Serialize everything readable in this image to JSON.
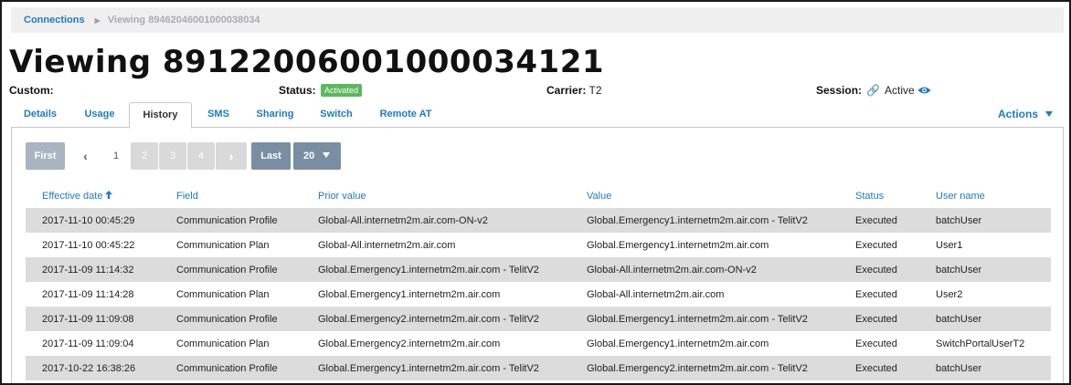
{
  "breadcrumb": {
    "root": "Connections",
    "current": "Viewing 89462046001000038034"
  },
  "page_title": "Viewing 89122006001000034121",
  "info": {
    "custom_label": "Custom:",
    "custom_value": "",
    "status_label": "Status:",
    "status_value": "Activated",
    "status_color": "#5cb85c",
    "carrier_label": "Carrier:",
    "carrier_value": "T2",
    "session_label": "Session:",
    "session_value": "Active",
    "session_icons": [
      "link-icon",
      "eye-icon"
    ]
  },
  "tabs": [
    {
      "label": "Details",
      "active": false
    },
    {
      "label": "Usage",
      "active": false
    },
    {
      "label": "History",
      "active": true
    },
    {
      "label": "SMS",
      "active": false
    },
    {
      "label": "Sharing",
      "active": false
    },
    {
      "label": "Switch",
      "active": false
    },
    {
      "label": "Remote AT",
      "active": false
    }
  ],
  "actions_label": "Actions",
  "pagination": {
    "first": "First",
    "pages": [
      "1",
      "2",
      "3",
      "4"
    ],
    "current_page": "1",
    "last": "Last",
    "page_size": "20"
  },
  "table": {
    "columns": [
      "Effective date",
      "Field",
      "Prior value",
      "Value",
      "Status",
      "User name"
    ],
    "sorted_column": "Effective date",
    "rows": [
      [
        "2017-11-10 00:45:29",
        "Communication Profile",
        "Global-All.internetm2m.air.com-ON-v2",
        "Global.Emergency1.internetm2m.air.com - TelitV2",
        "Executed",
        "batchUser"
      ],
      [
        "2017-11-10 00:45:22",
        "Communication Plan",
        "Global-All.internetm2m.air.com",
        "Global.Emergency1.internetm2m.air.com",
        "Executed",
        "User1"
      ],
      [
        "2017-11-09 11:14:32",
        "Communication Profile",
        "Global.Emergency1.internetm2m.air.com - TelitV2",
        "Global-All.internetm2m.air.com-ON-v2",
        "Executed",
        "batchUser"
      ],
      [
        "2017-11-09 11:14:28",
        "Communication Plan",
        "Global.Emergency1.internetm2m.air.com",
        "Global-All.internetm2m.air.com",
        "Executed",
        "User2"
      ],
      [
        "2017-11-09 11:09:08",
        "Communication Profile",
        "Global.Emergency2.internetm2m.air.com - TelitV2",
        "Global.Emergency1.internetm2m.air.com - TelitV2",
        "Executed",
        "batchUser"
      ],
      [
        "2017-11-09 11:09:04",
        "Communication Plan",
        "Global.Emergency2.internetm2m.air.com",
        "Global.Emergency1.internetm2m.air.com",
        "Executed",
        "SwitchPortalUserT2"
      ],
      [
        "2017-10-22 16:38:26",
        "Communication Profile",
        "Global.Emergency1.internetm2m.air.com - TelitV2",
        "Global.Emergency2.internetm2m.air.com - TelitV2",
        "Executed",
        "batchUser"
      ]
    ]
  },
  "colors": {
    "link": "#1e7bc4",
    "row_alt": "#dcdcdc",
    "pager_dark": "#7a8ea3"
  }
}
